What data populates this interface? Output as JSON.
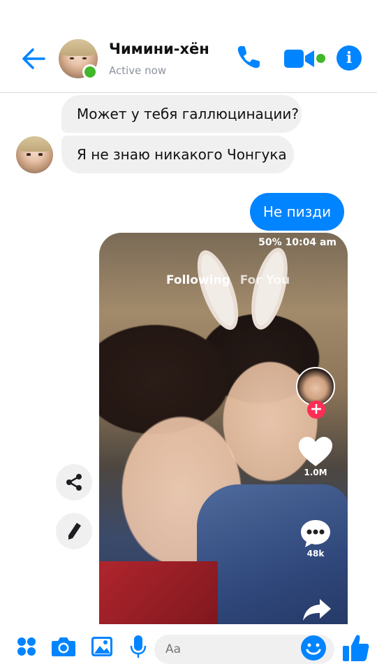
{
  "header": {
    "contact_name": "Чимини-хён",
    "status": "Active now"
  },
  "messages": [
    {
      "direction": "incoming",
      "text": "Может у тебя галлюцинации?"
    },
    {
      "direction": "incoming",
      "text": "Я не знаю никакого Чонгука"
    },
    {
      "direction": "outgoing",
      "text": "Не пизди"
    }
  ],
  "shared_image": {
    "status_bar": "50% 10:04 am",
    "tabs": [
      "Following",
      "For You"
    ],
    "like_count": "1.0M",
    "comment_count": "48k"
  },
  "composer": {
    "placeholder": "Aa"
  },
  "colors": {
    "accent": "#0084ff",
    "online": "#42b72a",
    "incoming_bubble": "#f1f0f0",
    "follow_badge": "#ff2d55"
  },
  "icons": {
    "back": "arrow-left-icon",
    "call": "phone-icon",
    "video": "video-camera-icon",
    "info": "info-icon",
    "share": "share-icon",
    "edit": "pencil-icon",
    "apps": "four-dots-icon",
    "camera": "camera-icon",
    "gallery": "image-icon",
    "mic": "microphone-icon",
    "emoji": "smiley-icon",
    "like": "thumbs-up-icon"
  }
}
